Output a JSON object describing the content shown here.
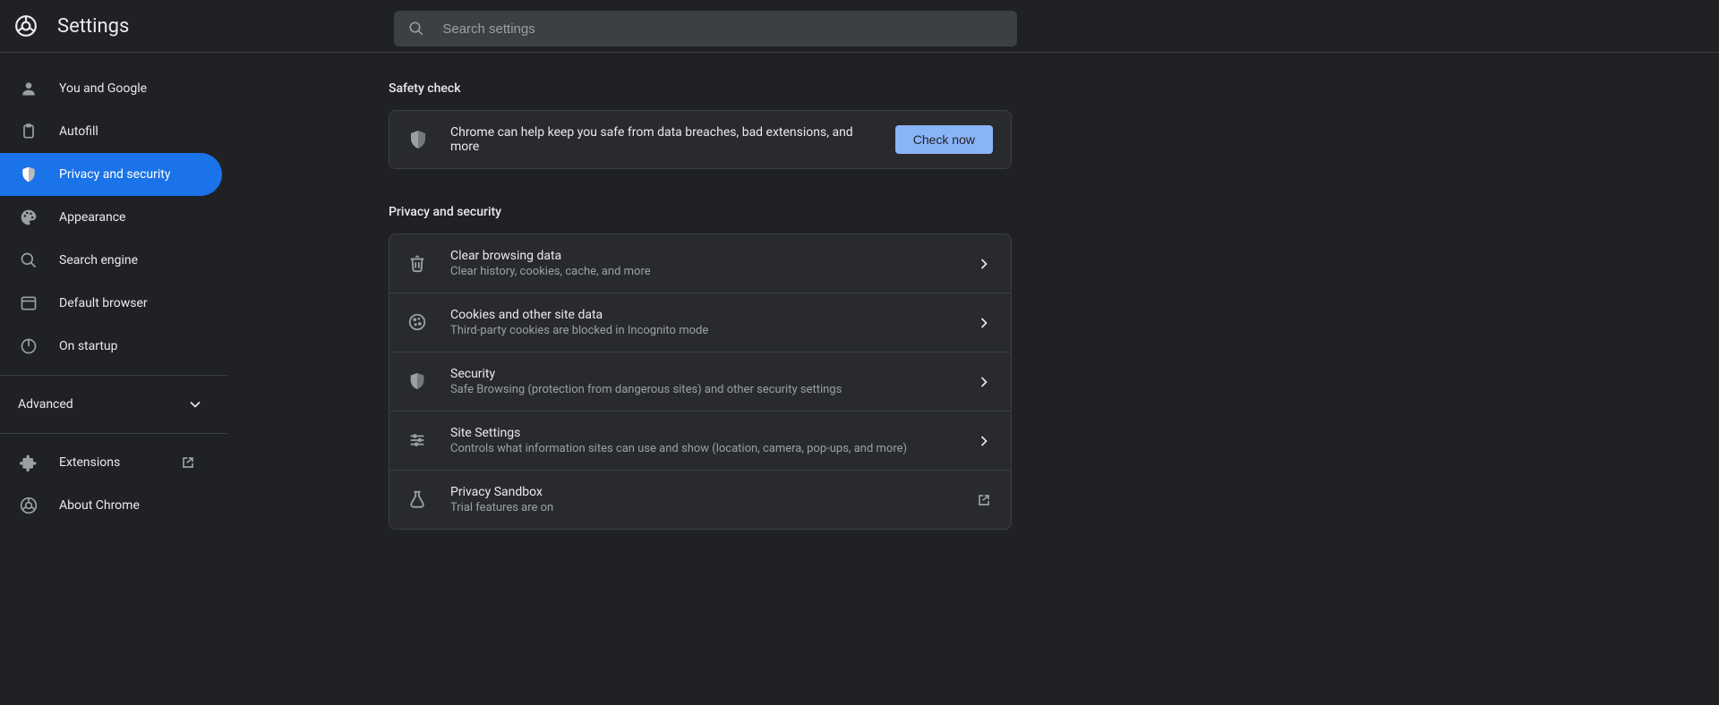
{
  "header": {
    "title": "Settings",
    "search_placeholder": "Search settings"
  },
  "sidebar": {
    "items": [
      {
        "label": "You and Google"
      },
      {
        "label": "Autofill"
      },
      {
        "label": "Privacy and security"
      },
      {
        "label": "Appearance"
      },
      {
        "label": "Search engine"
      },
      {
        "label": "Default browser"
      },
      {
        "label": "On startup"
      }
    ],
    "advanced_label": "Advanced",
    "extensions_label": "Extensions",
    "about_label": "About Chrome"
  },
  "safety": {
    "header": "Safety check",
    "message": "Chrome can help keep you safe from data breaches, bad extensions, and more",
    "button": "Check now"
  },
  "privacy": {
    "header": "Privacy and security",
    "items": [
      {
        "title": "Clear browsing data",
        "subtitle": "Clear history, cookies, cache, and more"
      },
      {
        "title": "Cookies and other site data",
        "subtitle": "Third-party cookies are blocked in Incognito mode"
      },
      {
        "title": "Security",
        "subtitle": "Safe Browsing (protection from dangerous sites) and other security settings"
      },
      {
        "title": "Site Settings",
        "subtitle": "Controls what information sites can use and show (location, camera, pop-ups, and more)"
      },
      {
        "title": "Privacy Sandbox",
        "subtitle": "Trial features are on"
      }
    ]
  },
  "colors": {
    "accent": "#8ab4f8",
    "active": "#1a73e8"
  }
}
